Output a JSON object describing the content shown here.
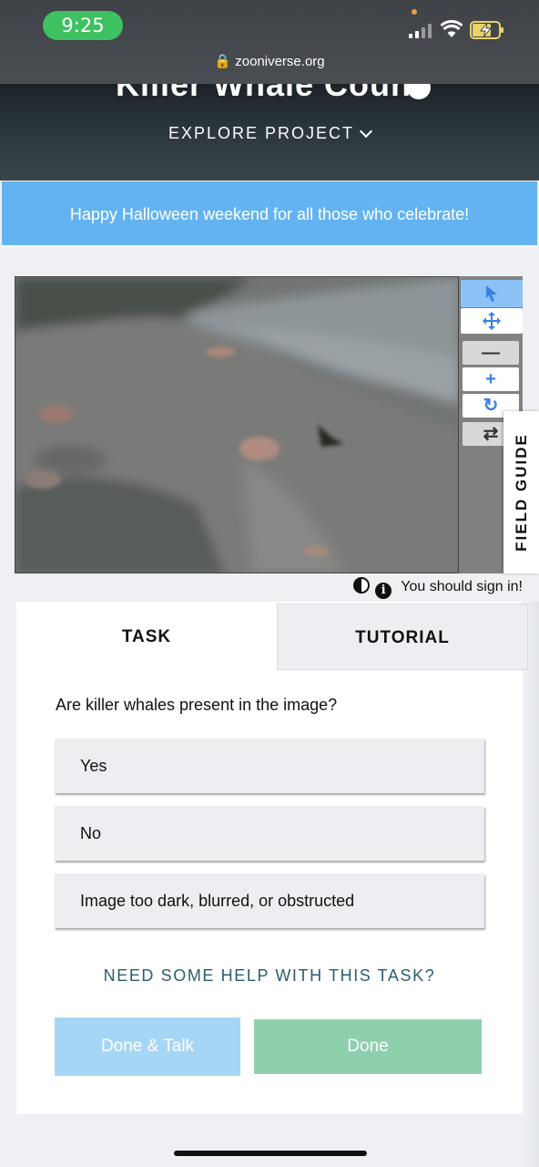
{
  "status_bar": {
    "time": "9:25",
    "url": "zooniverse.org"
  },
  "header": {
    "project_title": "Killer Whale Count",
    "explore_label": "EXPLORE PROJECT"
  },
  "banner": {
    "text": "Happy Halloween weekend for all those who celebrate!"
  },
  "toolbar": {
    "accent_color": "#3b80e8",
    "tools": [
      "pointer-icon",
      "move-icon",
      "zoom-out-icon",
      "zoom-in-icon",
      "rotate-icon",
      "reset-icon"
    ]
  },
  "field_guide": {
    "label": "FIELD GUIDE"
  },
  "meta": {
    "sign_in_text": "You should sign in!"
  },
  "tabs": {
    "task": "TASK",
    "tutorial": "TUTORIAL"
  },
  "task": {
    "question": "Are killer whales present in the image?",
    "answers": [
      "Yes",
      "No",
      "Image too dark, blurred, or obstructed"
    ],
    "help_link": "NEED SOME HELP WITH THIS TASK?",
    "done_talk_label": "Done & Talk",
    "done_label": "Done"
  }
}
